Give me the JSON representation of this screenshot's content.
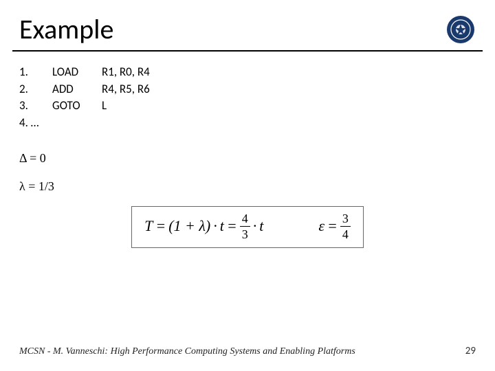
{
  "title": "Example",
  "code": {
    "rows": [
      {
        "n": "1.",
        "op": "LOAD",
        "args": "R1, R0, R4"
      },
      {
        "n": "2.",
        "op": "ADD",
        "args": "R4, R5, R6"
      },
      {
        "n": "3.",
        "op": "GOTO",
        "args": "L"
      },
      {
        "n": "4.  …",
        "op": "",
        "args": ""
      }
    ]
  },
  "delta_line": "Δ = 0",
  "lambda_line": "λ = 1/3",
  "formula": {
    "lhs_var": "T",
    "paren": "(1 + λ)",
    "dot": "·",
    "t": "t",
    "eq": "=",
    "frac1_num": "4",
    "frac1_den": "3",
    "eps_var": "ε",
    "frac2_num": "3",
    "frac2_den": "4"
  },
  "footer": {
    "text": "MCSN  -   M. Vanneschi: High Performance Computing Systems and Enabling Platforms",
    "page": "29"
  },
  "logo_label": "university-seal"
}
